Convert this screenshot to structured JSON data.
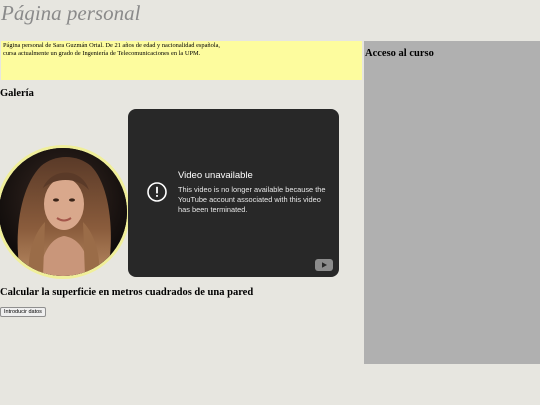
{
  "header": {
    "title": "Página personal"
  },
  "intro": {
    "line1": "Página personal de Sara Guzmán Ortal. De 21 años de edad y nacionalidad española,",
    "line2": "cursa actualmente un grado de Ingeniería de Telecomunicaciones en la UPM."
  },
  "sidebar": {
    "title": "Acceso al curso"
  },
  "gallery": {
    "title": "Galería"
  },
  "video": {
    "heading": "Video unavailable",
    "message": "This video is no longer available because the YouTube account associated with this video has been terminated.",
    "icon": "alert-circle-icon"
  },
  "wall": {
    "title": "Calcular la superficie en metros cuadrados de una pared",
    "button_label": "Introducir datos"
  },
  "colors": {
    "background": "#e7e6e0",
    "intro_box": "#fdfc9e",
    "sidebar": "#b0b0b0",
    "video_bg": "#282828"
  }
}
